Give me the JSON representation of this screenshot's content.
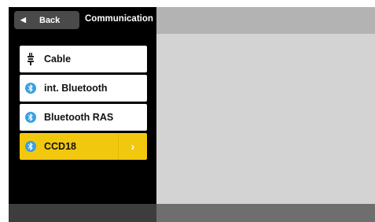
{
  "header": {
    "back_label": "Back",
    "title": "Communication"
  },
  "list": {
    "items": [
      {
        "label": "Cable",
        "icon": "cable-plug-icon"
      },
      {
        "label": "int. Bluetooth",
        "icon": "bluetooth-icon"
      },
      {
        "label": "Bluetooth RAS",
        "icon": "bluetooth-icon"
      },
      {
        "label": "CCD18",
        "icon": "bluetooth-icon",
        "selected": true
      }
    ]
  },
  "colors": {
    "accent": "#f2c80f",
    "bluetooth": "#3aa0e0",
    "panel_bg": "#d3d3d3"
  }
}
